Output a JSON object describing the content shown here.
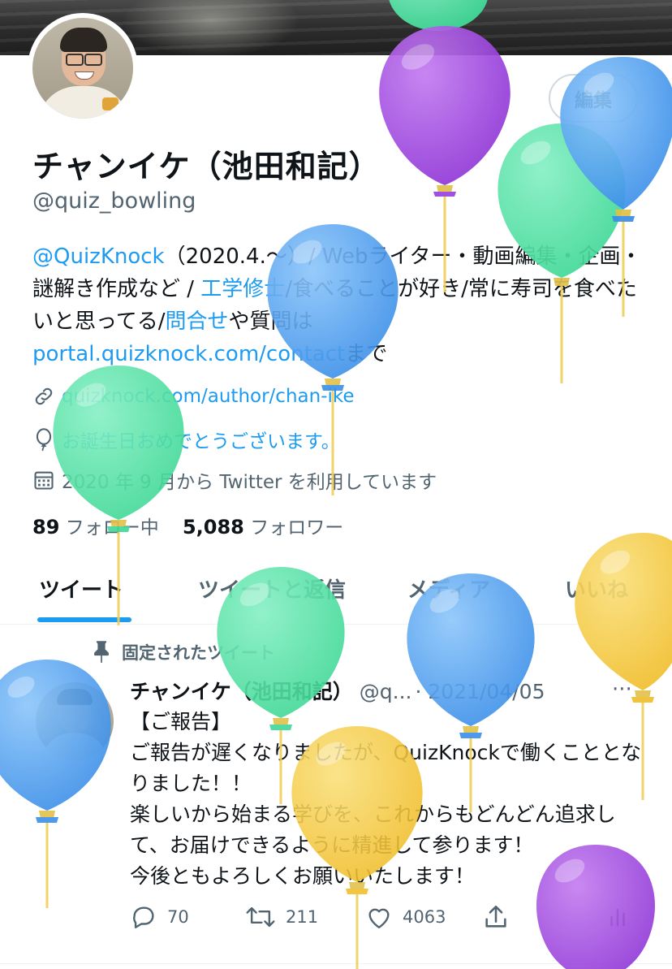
{
  "profile": {
    "name": "チャンイケ（池田和記）",
    "handle": "@quiz_bowling",
    "edit_label": "編集",
    "bio": {
      "mention": "@QuizKnock",
      "text1": "（2020.4.〜）/ Webライター・動画編集・企画・謎解き作成など / ",
      "link1": "工学修士",
      "text2": "/食べることが好き/常に寿司を食べたいと思ってる/",
      "link2": "問合せ",
      "text3": "や質問は",
      "link3": "portal.quizknock.com/contact",
      "text4": "まで"
    },
    "website": "quizknock.com/author/chan-ike",
    "birthday": "お誕生日おめでとうございます。",
    "joined": "2020 年 9 月から Twitter を利用しています",
    "following_count": "89",
    "following_label": "フォロー中",
    "followers_count": "5,088",
    "followers_label": "フォロワー"
  },
  "tabs": [
    {
      "label": "ツイート"
    },
    {
      "label": "ツイートと返信"
    },
    {
      "label": "メディア"
    },
    {
      "label": "いいね"
    }
  ],
  "pinned": {
    "label": "固定されたツイート",
    "author_name": "チャンイケ（池田和記）",
    "author_handle": "@q...",
    "date": "· 2021/04/05",
    "more": "···",
    "text": "【ご報告】\nご報告が遅くなりましたが、QuizKnockで働くこととなりました！！\n楽しいから始まる学びを、これからもどんどん追求して、お届けできるように精進して参ります！\n今後ともよろしくお願いいたします！",
    "replies": "70",
    "retweets": "211",
    "likes": "4063"
  },
  "icons": [
    "link-icon",
    "balloon-icon",
    "calendar-icon",
    "pin-icon",
    "reply-icon",
    "retweet-icon",
    "like-icon",
    "share-icon",
    "analytics-icon"
  ],
  "colors": {
    "accent": "#1d9bf0",
    "balloon_purple": "#a24ddf",
    "balloon_green": "#55e3a6",
    "balloon_blue": "#4a9ff0",
    "balloon_yellow": "#f5cb3c"
  }
}
